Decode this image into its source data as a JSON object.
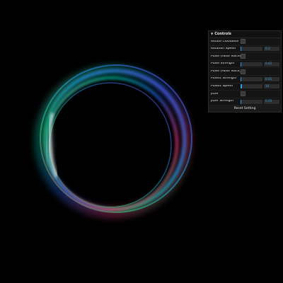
{
  "panel": {
    "title": "Controls",
    "reset_label": "Reset Setting",
    "rows": [
      {
        "label": "Rotate Clockwise",
        "type": "checkbox"
      },
      {
        "label": "Rotation Speed",
        "type": "slider",
        "value": "0.2",
        "fill": 0.03
      },
      {
        "label": "Pulse (False Voice)",
        "type": "checkbox"
      },
      {
        "label": "Pulse Strength",
        "type": "slider",
        "value": "0.02",
        "fill": 0.03
      },
      {
        "label": "Pulse (False Voice_2)",
        "type": "checkbox"
      },
      {
        "label": "Pulse2 Strength",
        "type": "slider",
        "value": "0.01",
        "fill": 0.03
      },
      {
        "label": "Pulse2 Speed",
        "type": "slider",
        "value": "10",
        "fill": 0.05
      },
      {
        "label": "jitter",
        "type": "checkbox"
      },
      {
        "label": "jitter Strength",
        "type": "slider",
        "value": "0.05",
        "fill": 0.03
      }
    ]
  },
  "colors": {
    "background": "#000000",
    "accent": "#2e9fe0",
    "ring": [
      "#ffffff",
      "#00e5a8",
      "#2a6bff",
      "#a040ff",
      "#ff3c6e",
      "#22d36b"
    ]
  }
}
